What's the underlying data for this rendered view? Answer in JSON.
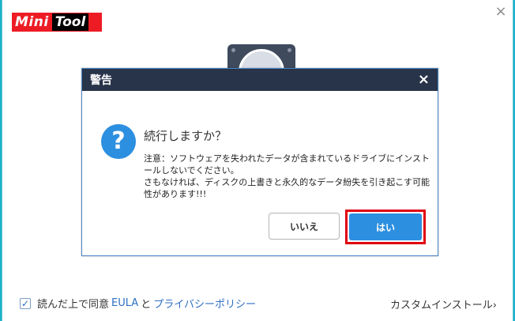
{
  "logo": {
    "part1": "Mini",
    "part2": "Tool"
  },
  "window": {
    "close_glyph": "×"
  },
  "dialog": {
    "title": "警告",
    "close_glyph": "×",
    "icon_glyph": "?",
    "question": "続行しますか？",
    "warning_line1": "注意：ソフトウェアを失われたデータが含まれているドライブにインストールしないでください。",
    "warning_line2": "さもなければ、ディスクの上書きと永久的なデータ紛失を引き起こす可能性があります!!!",
    "no_label": "いいえ",
    "yes_label": "はい"
  },
  "footer": {
    "checked": true,
    "check_glyph": "✓",
    "text_before": "読んだ上で同意",
    "eula_link": "EULA",
    "and_text": "と",
    "privacy_link": "プライバシーポリシー",
    "custom_install": "カスタムインストール›"
  },
  "colors": {
    "accent": "#2d8fe0",
    "title_bar": "#28344a",
    "highlight": "#e00010",
    "background": "#1bb3c9"
  }
}
